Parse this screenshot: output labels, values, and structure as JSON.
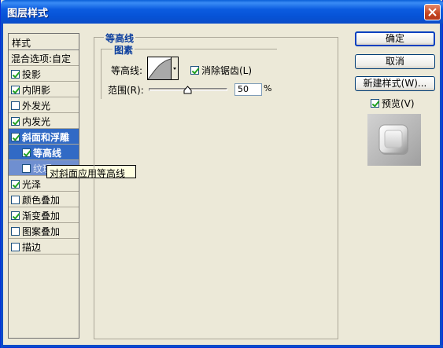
{
  "window": {
    "title": "图层样式"
  },
  "stylelist": {
    "header": "样式",
    "items": [
      {
        "label": "混合选项:自定",
        "checkbox": false,
        "checked": false,
        "state": "normal"
      },
      {
        "label": "投影",
        "checkbox": true,
        "checked": true,
        "state": "normal"
      },
      {
        "label": "内阴影",
        "checkbox": true,
        "checked": true,
        "state": "normal"
      },
      {
        "label": "外发光",
        "checkbox": true,
        "checked": false,
        "state": "normal"
      },
      {
        "label": "内发光",
        "checkbox": true,
        "checked": true,
        "state": "normal"
      },
      {
        "label": "斜面和浮雕",
        "checkbox": true,
        "checked": true,
        "state": "selected"
      },
      {
        "label": "等高线",
        "checkbox": true,
        "checked": true,
        "state": "sub-selected"
      },
      {
        "label": "纹理",
        "checkbox": true,
        "checked": false,
        "state": "sub"
      },
      {
        "label": "光泽",
        "checkbox": true,
        "checked": true,
        "state": "normal"
      },
      {
        "label": "颜色叠加",
        "checkbox": true,
        "checked": false,
        "state": "normal"
      },
      {
        "label": "渐变叠加",
        "checkbox": true,
        "checked": true,
        "state": "normal"
      },
      {
        "label": "图案叠加",
        "checkbox": true,
        "checked": false,
        "state": "normal"
      },
      {
        "label": "描边",
        "checkbox": true,
        "checked": false,
        "state": "normal"
      }
    ]
  },
  "tooltip": "对斜面应用等高线",
  "main": {
    "section_title": "等高线",
    "subsection_title": "图素",
    "contour_label": "等高线:",
    "antialias_label": "消除锯齿(L)",
    "antialias_checked": true,
    "range_label": "范围(R):",
    "range_value": "50",
    "range_unit": "%",
    "range_fraction": 0.5
  },
  "buttons": {
    "ok": "确定",
    "cancel": "取消",
    "new_style": "新建样式(W)...",
    "preview_label": "预览(V)",
    "preview_checked": true
  },
  "colors": {
    "titlebar": "#0a5fd8",
    "selection": "#316ac5",
    "group_title": "#0a3d9d",
    "tooltip_bg": "#ffffe1"
  }
}
